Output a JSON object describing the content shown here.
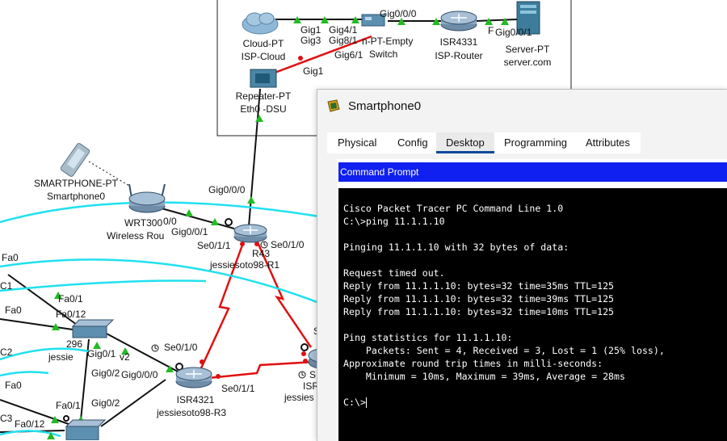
{
  "topology": {
    "devices": {
      "cloud": {
        "type": "Cloud-PT",
        "name": "ISP-Cloud"
      },
      "switch_top": {
        "type": "n-PT-Empty",
        "name": "Switch"
      },
      "isp_router": {
        "type": "ISR4331",
        "name": "ISP-Router"
      },
      "server": {
        "type": "Server-PT",
        "name": "server.com"
      },
      "repeater": {
        "type": "Repeater-PT",
        "name": "Eth0 -DSU"
      },
      "smartphone": {
        "type": "SMARTPHONE-PT",
        "name": "Smartphone0"
      },
      "wireless": {
        "type": "WRT300",
        "name": "Wireless Rou"
      },
      "r1": {
        "type": "R43",
        "name": "jessiesoto98-R1"
      },
      "switch1": {
        "type": "296",
        "name": "jessie"
      },
      "r3": {
        "type": "ISR4321",
        "name": "jessiesoto98-R3"
      },
      "r2": {
        "type": "ISR",
        "name": "jessies"
      }
    },
    "ports": {
      "gig1_cloud": "Gig1",
      "gig3": "Gig3",
      "gig4_1": "Gig4/1",
      "gig8_1": "Gig8/1",
      "gig6_1": "Gig6/1",
      "gig0_0_0_top": "Gig0/0/0",
      "gig0_0_1_top": "Gig0/0/1",
      "f_top": "F",
      "gig1_rep": "Gig1",
      "gig0_0_0_r1": "Gig0/0/0",
      "wr_0_0": "0/0",
      "gig0_0_1_wr": "Gig0/0/1",
      "se0_1_1_r1": "Se0/1/1",
      "se0_1_0_r1": "Se0/1/0",
      "fa0_a": "Fa0",
      "c1": "C1",
      "fa0_1_a": "Fa0/1",
      "fa0_b": "Fa0",
      "fa0_12_a": "Fa0/12",
      "gig0_1": "Gig0/1",
      "v2": "v2",
      "c2": "C2",
      "se0_1_0_r3": "Se0/1/0",
      "gig0_2_a": "Gig0/2",
      "gig0_0_0_r3": "Gig0/0/0",
      "fa0_c": "Fa0",
      "gig0_2_b": "Gig0/2",
      "fa0_1_b": "Fa0/1",
      "c3": "C3",
      "fa0_12_b": "Fa0/12",
      "se0_1_1_r3": "Se0/1/1",
      "s_r2": "S",
      "s_r2b": "S"
    }
  },
  "window": {
    "title": "Smartphone0",
    "tabs": [
      "Physical",
      "Config",
      "Desktop",
      "Programming",
      "Attributes"
    ],
    "active_tab": "Desktop",
    "command_prompt_title": "Command Prompt",
    "terminal_lines": [
      "Cisco Packet Tracer PC Command Line 1.0",
      "C:\\>ping 11.1.1.10",
      "",
      "Pinging 11.1.1.10 with 32 bytes of data:",
      "",
      "Request timed out.",
      "Reply from 11.1.1.10: bytes=32 time=35ms TTL=125",
      "Reply from 11.1.1.10: bytes=32 time=39ms TTL=125",
      "Reply from 11.1.1.10: bytes=32 time=10ms TTL=125",
      "",
      "Ping statistics for 11.1.1.10:",
      "    Packets: Sent = 4, Received = 3, Lost = 1 (25% loss),",
      "Approximate round trip times in milli-seconds:",
      "    Minimum = 10ms, Maximum = 39ms, Average = 28ms",
      "",
      "C:\\>"
    ]
  },
  "colors": {
    "cmd_bar": "#1020f0",
    "terminal_bg": "#000000",
    "serial_link": "#e01010",
    "wireless_link": "#20e0f0",
    "link_ok": "#22bb22"
  }
}
